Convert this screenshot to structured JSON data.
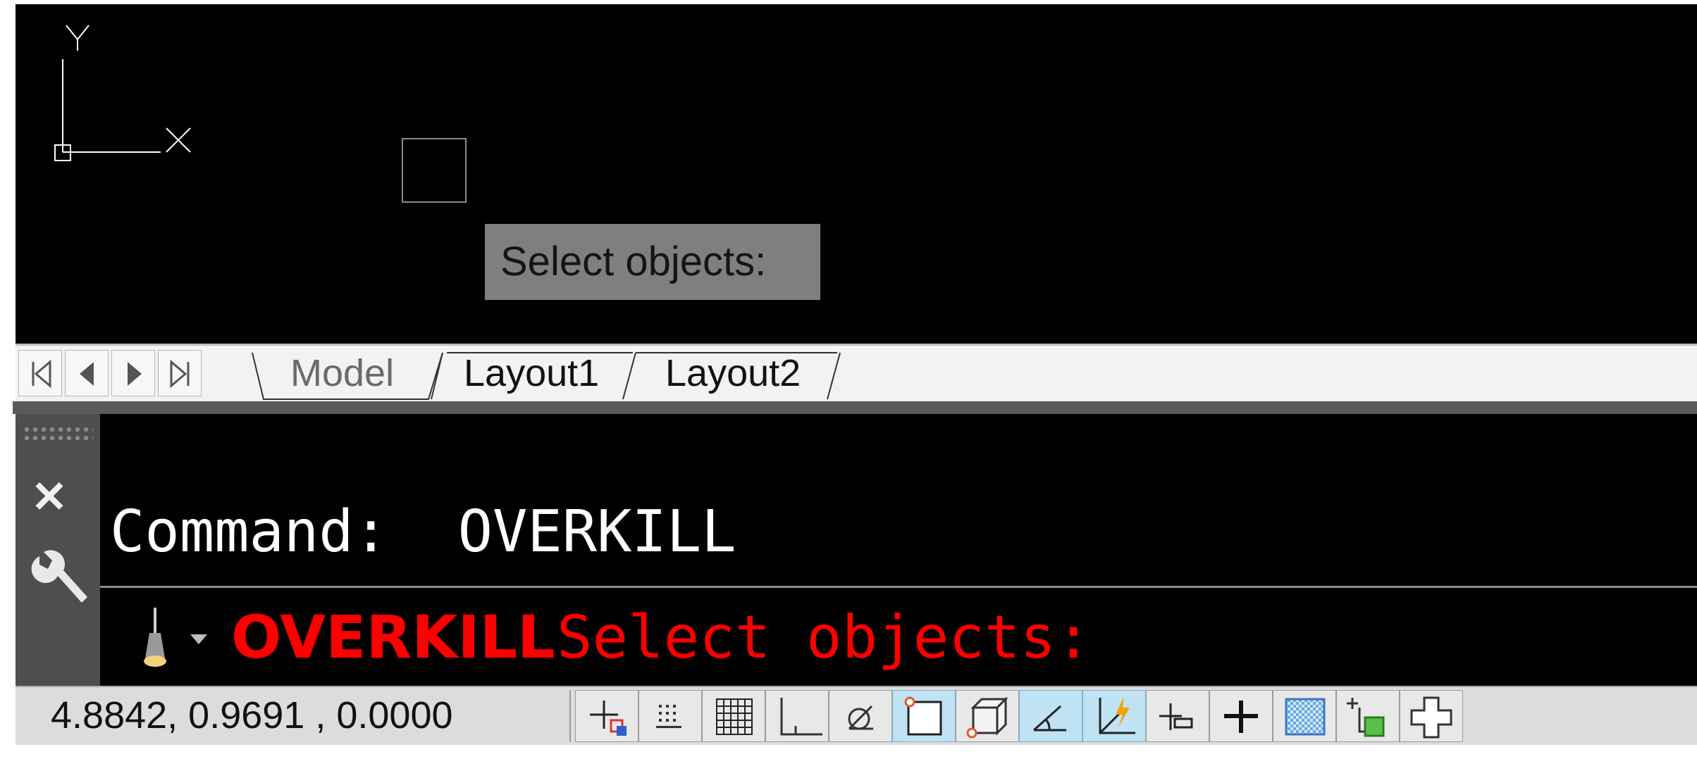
{
  "viewport": {
    "ucs_icon": "ucs-icon",
    "ucs_y_label": "Y",
    "ucs_x_label": "X",
    "tooltip": "Select objects:"
  },
  "tabs": {
    "nav_icons": [
      "first-tab-icon",
      "prev-tab-icon",
      "next-tab-icon",
      "last-tab-icon"
    ],
    "items": [
      {
        "label": "Model",
        "active": true
      },
      {
        "label": "Layout1",
        "active": false
      },
      {
        "label": "Layout2",
        "active": false
      }
    ]
  },
  "command": {
    "history_line": "Command:  OVERKILL",
    "prompt_command": "OVERKILL",
    "prompt_text": "Select objects:",
    "prompt_color": "#ff0000",
    "close_icon": "close-icon",
    "customize_icon": "wrench-icon",
    "recent_commands_icon": "command-prompt-icon"
  },
  "status_bar": {
    "coordinates": "4.8842,  0.9691 , 0.0000",
    "toggles": [
      {
        "name": "infer-constraints-icon",
        "on": false
      },
      {
        "name": "snap-mode-icon",
        "on": false
      },
      {
        "name": "grid-display-icon",
        "on": false
      },
      {
        "name": "ortho-mode-icon",
        "on": false
      },
      {
        "name": "polar-tracking-icon",
        "on": false
      },
      {
        "name": "object-snap-icon",
        "on": true
      },
      {
        "name": "3d-object-snap-icon",
        "on": false
      },
      {
        "name": "object-snap-tracking-icon",
        "on": true
      },
      {
        "name": "dynamic-ucs-icon",
        "on": true
      },
      {
        "name": "dynamic-input-icon",
        "on": false
      },
      {
        "name": "lineweight-icon",
        "on": false
      },
      {
        "name": "transparency-icon",
        "on": false
      },
      {
        "name": "quick-properties-icon",
        "on": false
      },
      {
        "name": "selection-cycling-icon",
        "on": false
      }
    ]
  }
}
